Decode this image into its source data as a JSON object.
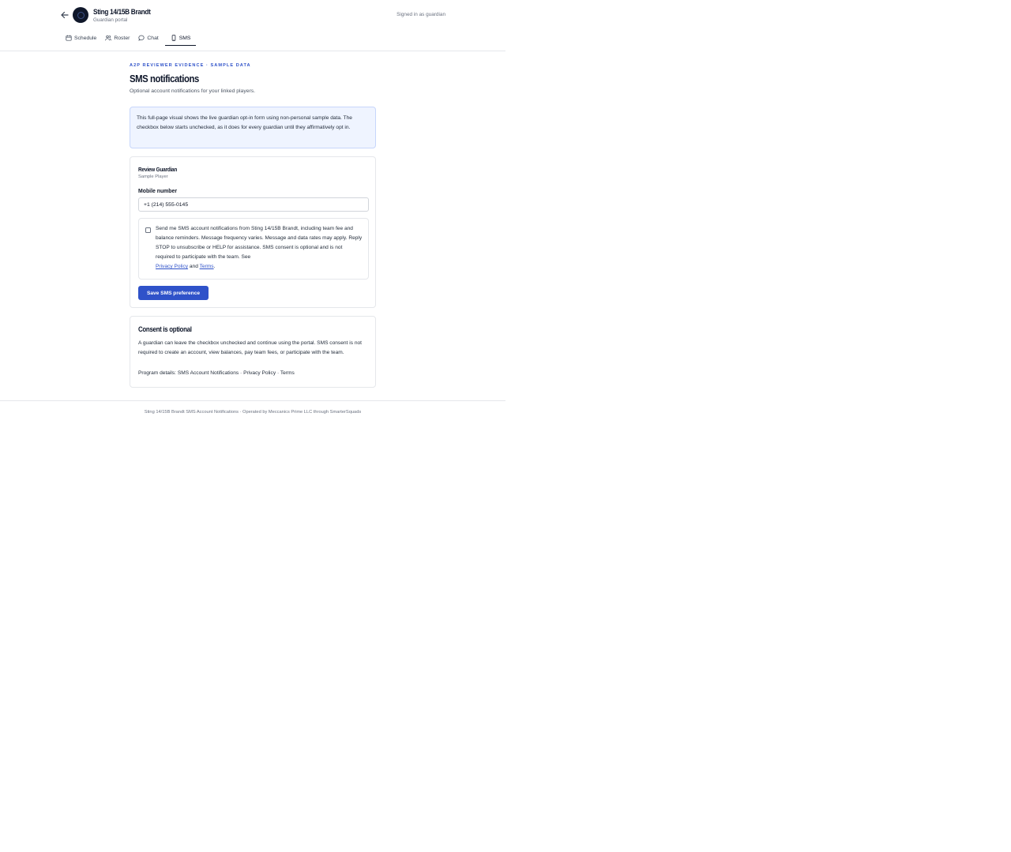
{
  "header": {
    "team_name": "Sting 14/15B Brandt",
    "portal_label": "Guardian portal",
    "signed_in_text": "Signed in as guardian"
  },
  "tabs": [
    {
      "label": "Schedule",
      "icon": "calendar-icon"
    },
    {
      "label": "Roster",
      "icon": "users-icon"
    },
    {
      "label": "Chat",
      "icon": "chat-bubble-icon"
    },
    {
      "label": "SMS",
      "icon": "phone-icon",
      "active": true
    }
  ],
  "main": {
    "eyebrow": "A2P REVIEWER EVIDENCE · SAMPLE DATA",
    "title": "SMS notifications",
    "description": "Optional account notifications for your linked players.",
    "notice": "This full-page visual shows the live guardian opt-in form using non-personal sample data. The checkbox below starts unchecked, as it does for every guardian until they affirmatively opt in."
  },
  "form": {
    "guardian_name": "Review Guardian",
    "player_name": "Sample Player",
    "mobile_label": "Mobile number",
    "mobile_value": "+1 (214) 555-0145",
    "consent_checked": false,
    "consent_text": "Send me SMS account notifications from Sting 14/15B Brandt, including team fee and balance reminders. Message frequency varies. Message and data rates may apply. Reply STOP to unsubscribe or HELP for assistance. SMS consent is optional and is not required to participate with the team. See",
    "privacy_link": "Privacy Policy",
    "and_text": "and",
    "terms_link": "Terms",
    "period": ".",
    "save_label": "Save SMS preference"
  },
  "consent_info": {
    "title": "Consent is optional",
    "body": "A guardian can leave the checkbox unchecked and continue using the portal. SMS consent is not required to create an account, view balances, pay team fees, or participate with the team.",
    "program_prefix": "Program details:",
    "program_name": "SMS Account Notifications",
    "privacy_label": "Privacy Policy",
    "terms_label": "Terms",
    "separator": "·"
  },
  "footer": {
    "text": "Sting 14/15B Brandt SMS Account Notifications · Operated by Meccanics Prime LLC through SmarterSquads"
  },
  "colors": {
    "accent": "#2f52c9",
    "notice_bg": "#eff4ff",
    "notice_border": "#c7d6fb",
    "text_primary": "#0f172a",
    "text_muted": "#6b7280"
  }
}
